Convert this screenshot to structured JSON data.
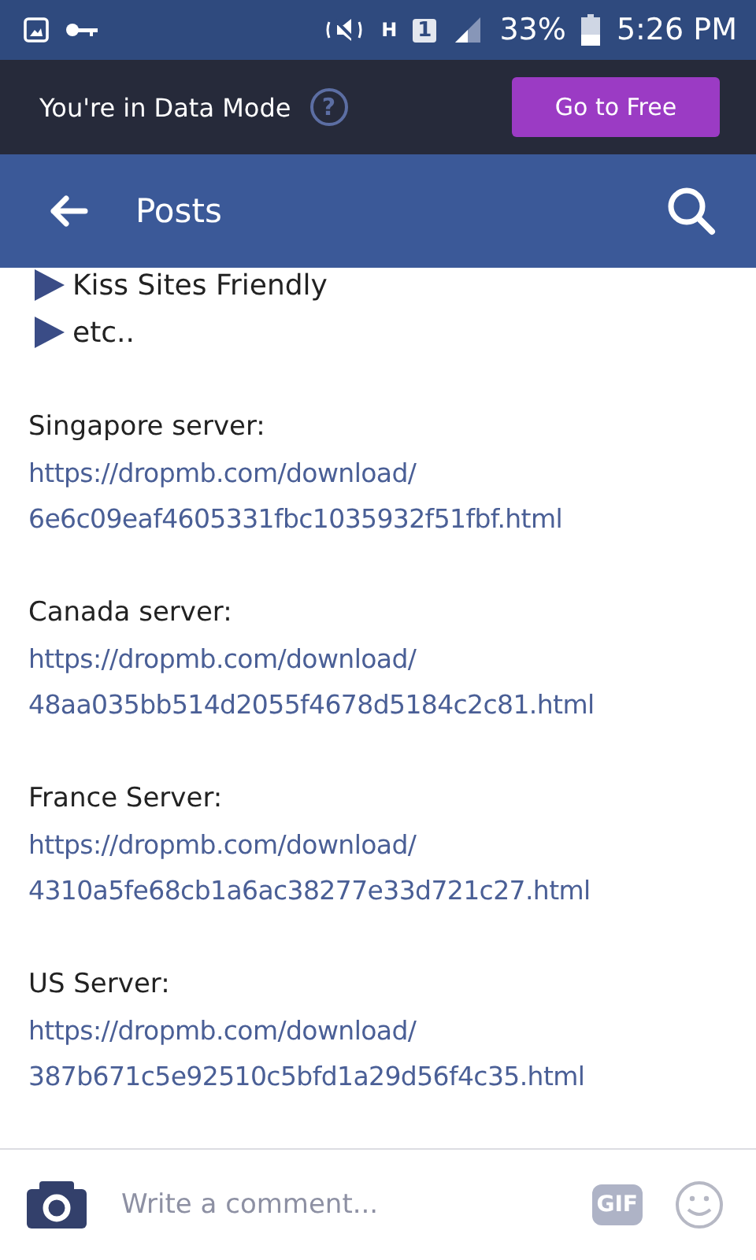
{
  "status_bar": {
    "network_type": "H",
    "sim_slot": "1",
    "battery": "33%",
    "time": "5:26 PM"
  },
  "data_mode_banner": {
    "text": "You're in Data Mode",
    "help": "?",
    "button": "Go to Free"
  },
  "app_bar": {
    "title": "Posts"
  },
  "post": {
    "bullets": [
      "Kiss Sites Friendly",
      "etc.."
    ],
    "servers": [
      {
        "label": "Singapore server:",
        "link": "https://dropmb.com/download/",
        "file": "6e6c09eaf4605331fbc1035932f51fbf.html"
      },
      {
        "label": "Canada server:",
        "link": "https://dropmb.com/download/",
        "file": "48aa035bb514d2055f4678d5184c2c81.html"
      },
      {
        "label": "France Server:",
        "link": "https://dropmb.com/download/",
        "file": "4310a5fe68cb1a6ac38277e33d721c27.html"
      },
      {
        "label": "US Server:",
        "link": "https://dropmb.com/download/",
        "file": "387b671c5e92510c5bfd1a29d56f4c35.html"
      }
    ]
  },
  "comment_bar": {
    "placeholder": "Write a comment...",
    "gif": "GIF"
  }
}
